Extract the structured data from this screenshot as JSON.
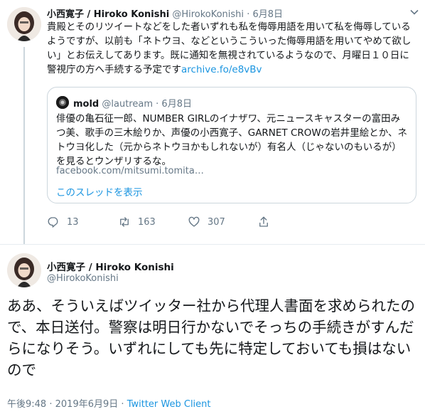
{
  "tweet1": {
    "display_name": "小西寛子 / Hiroko Konishi",
    "handle": "@HirokoKonishi",
    "separator": "·",
    "date": "6月8日",
    "text": "貴殿とそのリツイートなどをした者いずれも私を侮辱用語を用いて私を侮辱しているようですが、以前も「ネトウヨ、などというこういった侮辱用語を用いてやめて欲しい」とお伝えしてあります。既に通知を無視されているようなので、月曜日１０日に警視庁の方へ手続する予定です",
    "link": "archive.fo/e8vBv",
    "counts": {
      "replies": "13",
      "retweets": "163",
      "likes": "307"
    },
    "icons": [
      "reply-icon",
      "retweet-icon",
      "like-icon",
      "share-icon",
      "chevron-down-icon"
    ]
  },
  "quote": {
    "display_name": "mold",
    "handle": "@lautream",
    "separator": "·",
    "date": "6月8日",
    "text": "俳優の亀石征一郎、NUMBER GIRLのイナザワ、元ニュースキャスターの富田みつ美、歌手の三木絵りか、声優の小西寛子、GARNET CROWの岩井里絵とか、ネトウヨ化した（元からネトウヨかもしれないが）有名人（じゃないのもいるが）を見るとウンザリするな。",
    "link": "facebook.com/mitsumi.tomita…",
    "show_thread": "このスレッドを表示"
  },
  "tweet2": {
    "display_name": "小西寛子 / Hiroko Konishi",
    "handle": "@HirokoKonishi",
    "text": "ああ、そういえばツイッター社から代理人書面を求められたので、本日送付。警察は明日行かないでそっちの手続きがすんだらになりそう。いずれにしても先に特定しておいても損はないので",
    "timestamp": "午後9:48",
    "separator": "·",
    "date": "2019年6月9日",
    "source": "Twitter Web Client"
  },
  "colors": {
    "link": "#1b95e0",
    "secondary": "#657786",
    "border": "#ccd6dd",
    "text": "#14171a"
  }
}
